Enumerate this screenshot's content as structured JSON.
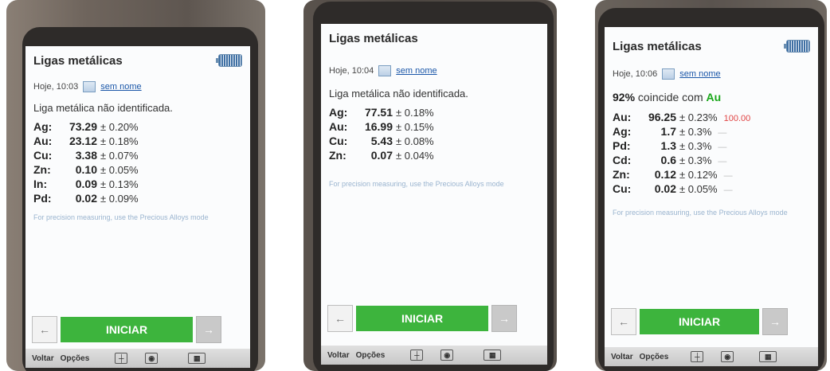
{
  "panels": [
    {
      "title": "Ligas metálicas",
      "time": "Hoje, 10:03",
      "name_link": "sem nome",
      "status": "Liga metálica não identificada.",
      "rows": [
        {
          "el": "Ag:",
          "val": "73.29",
          "err": "± 0.20%"
        },
        {
          "el": "Au:",
          "val": "23.12",
          "err": "± 0.18%"
        },
        {
          "el": "Cu:",
          "val": "3.38",
          "err": "± 0.07%"
        },
        {
          "el": "Zn:",
          "val": "0.10",
          "err": "± 0.05%"
        },
        {
          "el": "In:",
          "val": "0.09",
          "err": "± 0.13%"
        },
        {
          "el": "Pd:",
          "val": "0.02",
          "err": "± 0.09%"
        }
      ],
      "note": "For precision measuring, use the Precious Alloys mode",
      "back_arrow": "←",
      "start": "INICIAR",
      "next_arrow": "→",
      "bottom": {
        "voltar": "Voltar",
        "opcoes": "Opções"
      }
    },
    {
      "title": "Ligas metálicas",
      "time": "Hoje, 10:04",
      "name_link": "sem nome",
      "status": "Liga metálica não identificada.",
      "rows": [
        {
          "el": "Ag:",
          "val": "77.51",
          "err": "± 0.18%"
        },
        {
          "el": "Au:",
          "val": "16.99",
          "err": "± 0.15%"
        },
        {
          "el": "Cu:",
          "val": "5.43",
          "err": "± 0.08%"
        },
        {
          "el": "Zn:",
          "val": "0.07",
          "err": "± 0.04%"
        }
      ],
      "note": "For precision measuring, use the Precious Alloys mode",
      "back_arrow": "←",
      "start": "INICIAR",
      "next_arrow": "→",
      "bottom": {
        "voltar": "Voltar",
        "opcoes": "Opções"
      }
    },
    {
      "title": "Ligas metálicas",
      "time": "Hoje, 10:06",
      "name_link": "sem nome",
      "status_pct": "92%",
      "status_text": "coincide com",
      "status_alloy": "Au",
      "rows": [
        {
          "el": "Au:",
          "val": "96.25",
          "err": "± 0.23%",
          "extra": "100.00"
        },
        {
          "el": "Ag:",
          "val": "1.7",
          "err": "± 0.3%",
          "extra": "—"
        },
        {
          "el": "Pd:",
          "val": "1.3",
          "err": "± 0.3%",
          "extra": "—"
        },
        {
          "el": "Cd:",
          "val": "0.6",
          "err": "± 0.3%",
          "extra": "—"
        },
        {
          "el": "Zn:",
          "val": "0.12",
          "err": "± 0.12%",
          "extra": "—"
        },
        {
          "el": "Cu:",
          "val": "0.02",
          "err": "± 0.05%",
          "extra": "—"
        }
      ],
      "note": "For precision measuring, use the Precious Alloys mode",
      "back_arrow": "←",
      "start": "INICIAR",
      "next_arrow": "→",
      "bottom": {
        "voltar": "Voltar",
        "opcoes": "Opções"
      }
    }
  ],
  "colors": {
    "start_green": "#3db43d",
    "link_blue": "#1a56a8",
    "match_green": "#1aa71a",
    "ref_red": "#e04444"
  }
}
